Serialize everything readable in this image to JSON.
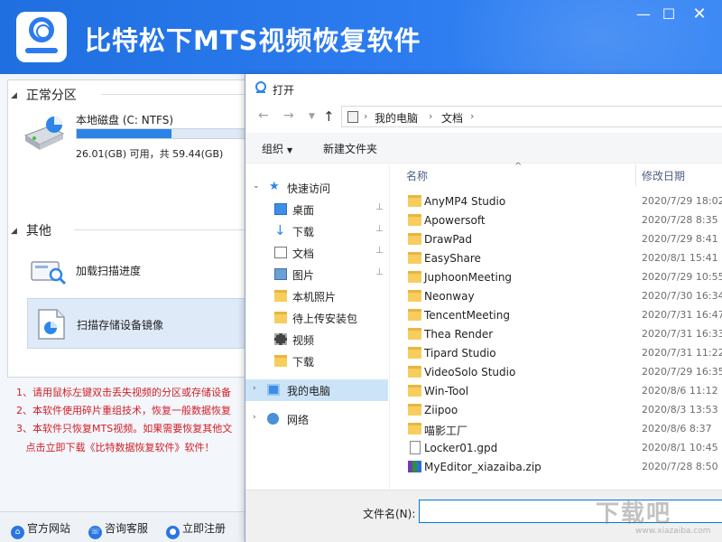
{
  "app": {
    "title": "比特松下MTS视频恢复软件",
    "window_controls": {
      "minimize": "—",
      "maximize": "☐",
      "close": "✕"
    },
    "sections": {
      "normal_partition": "正常分区",
      "other": "其他"
    },
    "disk": {
      "name": "本地磁盘 (C: NTFS)",
      "size_text": "26.01(GB) 可用，共 59.44(GB)",
      "used_fraction": 0.56
    },
    "other_items": {
      "load_progress": "加载扫描进度",
      "scan_image": "扫描存储设备镜像"
    },
    "notes": [
      "1、请用鼠标左键双击丢失视频的分区或存储设备",
      "2、本软件使用碎片重组技术，恢复一般数据恢复",
      "3、本软件只恢复MTS视频。如果需要恢复其他文",
      "   点击立即下载《比特数据恢复软件》软件！"
    ],
    "footer": {
      "website": "官方网站",
      "support": "咨询客服",
      "register": "立即注册"
    }
  },
  "dialog": {
    "title": "打开",
    "address": {
      "pc": "我的电脑",
      "docs": "文档"
    },
    "toolbar": {
      "organize": "组织",
      "new_folder": "新建文件夹"
    },
    "nav": {
      "quick_access": "快速访问",
      "items": [
        {
          "label": "桌面",
          "icon": "desktop-icon",
          "pinned": true
        },
        {
          "label": "下载",
          "icon": "download-icon",
          "pinned": true
        },
        {
          "label": "文档",
          "icon": "documents-icon",
          "pinned": true
        },
        {
          "label": "图片",
          "icon": "pictures-icon",
          "pinned": true
        },
        {
          "label": "本机照片",
          "icon": "folder-icon",
          "pinned": false
        },
        {
          "label": "待上传安装包",
          "icon": "folder-icon",
          "pinned": false
        },
        {
          "label": "视频",
          "icon": "video-icon",
          "pinned": false
        },
        {
          "label": "下载",
          "icon": "folder-icon",
          "pinned": false
        }
      ],
      "my_pc": "我的电脑",
      "network": "网络"
    },
    "columns": {
      "name": "名称",
      "date": "修改日期"
    },
    "files": [
      {
        "name": "AnyMP4 Studio",
        "date": "2020/7/29 18:02",
        "type": "folder"
      },
      {
        "name": "Apowersoft",
        "date": "2020/7/28 8:35",
        "type": "folder"
      },
      {
        "name": "DrawPad",
        "date": "2020/7/29 8:41",
        "type": "folder"
      },
      {
        "name": "EasyShare",
        "date": "2020/8/1 15:41",
        "type": "folder"
      },
      {
        "name": "JuphoonMeeting",
        "date": "2020/7/29 10:55",
        "type": "folder"
      },
      {
        "name": "Neonway",
        "date": "2020/7/30 16:34",
        "type": "folder"
      },
      {
        "name": "TencentMeeting",
        "date": "2020/7/31 16:47",
        "type": "folder"
      },
      {
        "name": "Thea Render",
        "date": "2020/7/31 16:33",
        "type": "folder"
      },
      {
        "name": "Tipard Studio",
        "date": "2020/7/31 11:22",
        "type": "folder"
      },
      {
        "name": "VideoSolo Studio",
        "date": "2020/7/29 16:35",
        "type": "folder"
      },
      {
        "name": "Win-Tool",
        "date": "2020/8/6 11:12",
        "type": "folder"
      },
      {
        "name": "Ziipoo",
        "date": "2020/8/3 13:53",
        "type": "folder"
      },
      {
        "name": "喵影工厂",
        "date": "2020/8/6 8:37",
        "type": "folder"
      },
      {
        "name": "Locker01.gpd",
        "date": "2020/8/1 10:45",
        "type": "doc"
      },
      {
        "name": "MyEditor_xiazaiba.zip",
        "date": "2020/7/28 8:50",
        "type": "zip"
      }
    ],
    "filename_label": "文件名(N):",
    "filename_value": ""
  },
  "watermark": {
    "main": "下载吧",
    "sub": "www.xiazaiba.com"
  },
  "colors": {
    "brand": "#2b7bef",
    "note_red": "#d0202a",
    "selection": "#cce4f7"
  }
}
